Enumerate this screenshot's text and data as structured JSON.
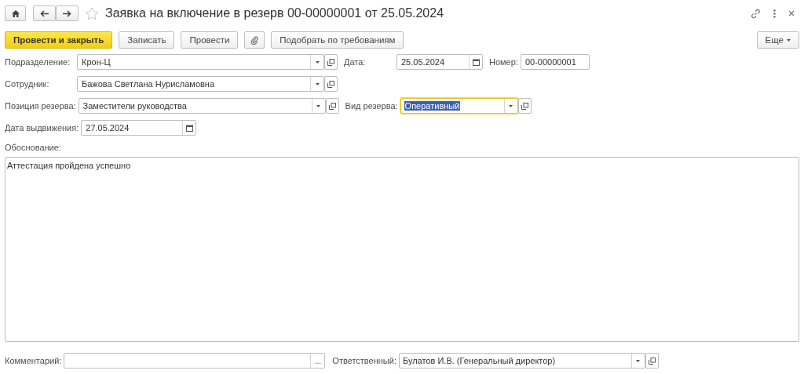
{
  "window": {
    "title": "Заявка на включение в резерв 00-00000001 от 25.05.2024"
  },
  "toolbar": {
    "buttons": [
      {
        "label": "Провести и закрыть",
        "kind": "primary"
      },
      {
        "label": "Записать",
        "kind": "plain"
      },
      {
        "label": "Провести",
        "kind": "plain"
      },
      {
        "kind": "attach"
      },
      {
        "label": "Подобрать по требованиям",
        "kind": "plain"
      }
    ],
    "more": "Еще"
  },
  "rows": [
    [
      {
        "label": "Подразделение:",
        "value": "Крон-Ц",
        "kind": "choice",
        "focused": false
      },
      {
        "label": "Дата:",
        "value": "25.05.2024",
        "kind": "date",
        "focused": false
      },
      {
        "label": "Номер:",
        "value": "00-00000001",
        "kind": "text",
        "focused": false
      }
    ],
    [
      {
        "label": "Сотрудник:",
        "value": "Бажова Светлана Нурисламовна",
        "kind": "choice",
        "focused": false
      }
    ],
    [
      {
        "label": "Позиция резерва:",
        "value": "Заместители руководства",
        "kind": "choice",
        "focused": false
      },
      {
        "label": "Вид резерва:",
        "value": "Оперативный",
        "kind": "choice",
        "focused": true
      }
    ],
    [
      {
        "label": "Дата выдвижения:",
        "value": "27.05.2024",
        "kind": "date",
        "focused": false
      }
    ]
  ],
  "justification": {
    "label": "Обоснование:",
    "value": "Аттестация пройдена успешно"
  },
  "footer": {
    "comment": {
      "label": "Комментарий:",
      "button": "..."
    },
    "responsible": {
      "label": "Ответственный:",
      "value": "Булатов И.В. (Генеральный директор)"
    }
  }
}
